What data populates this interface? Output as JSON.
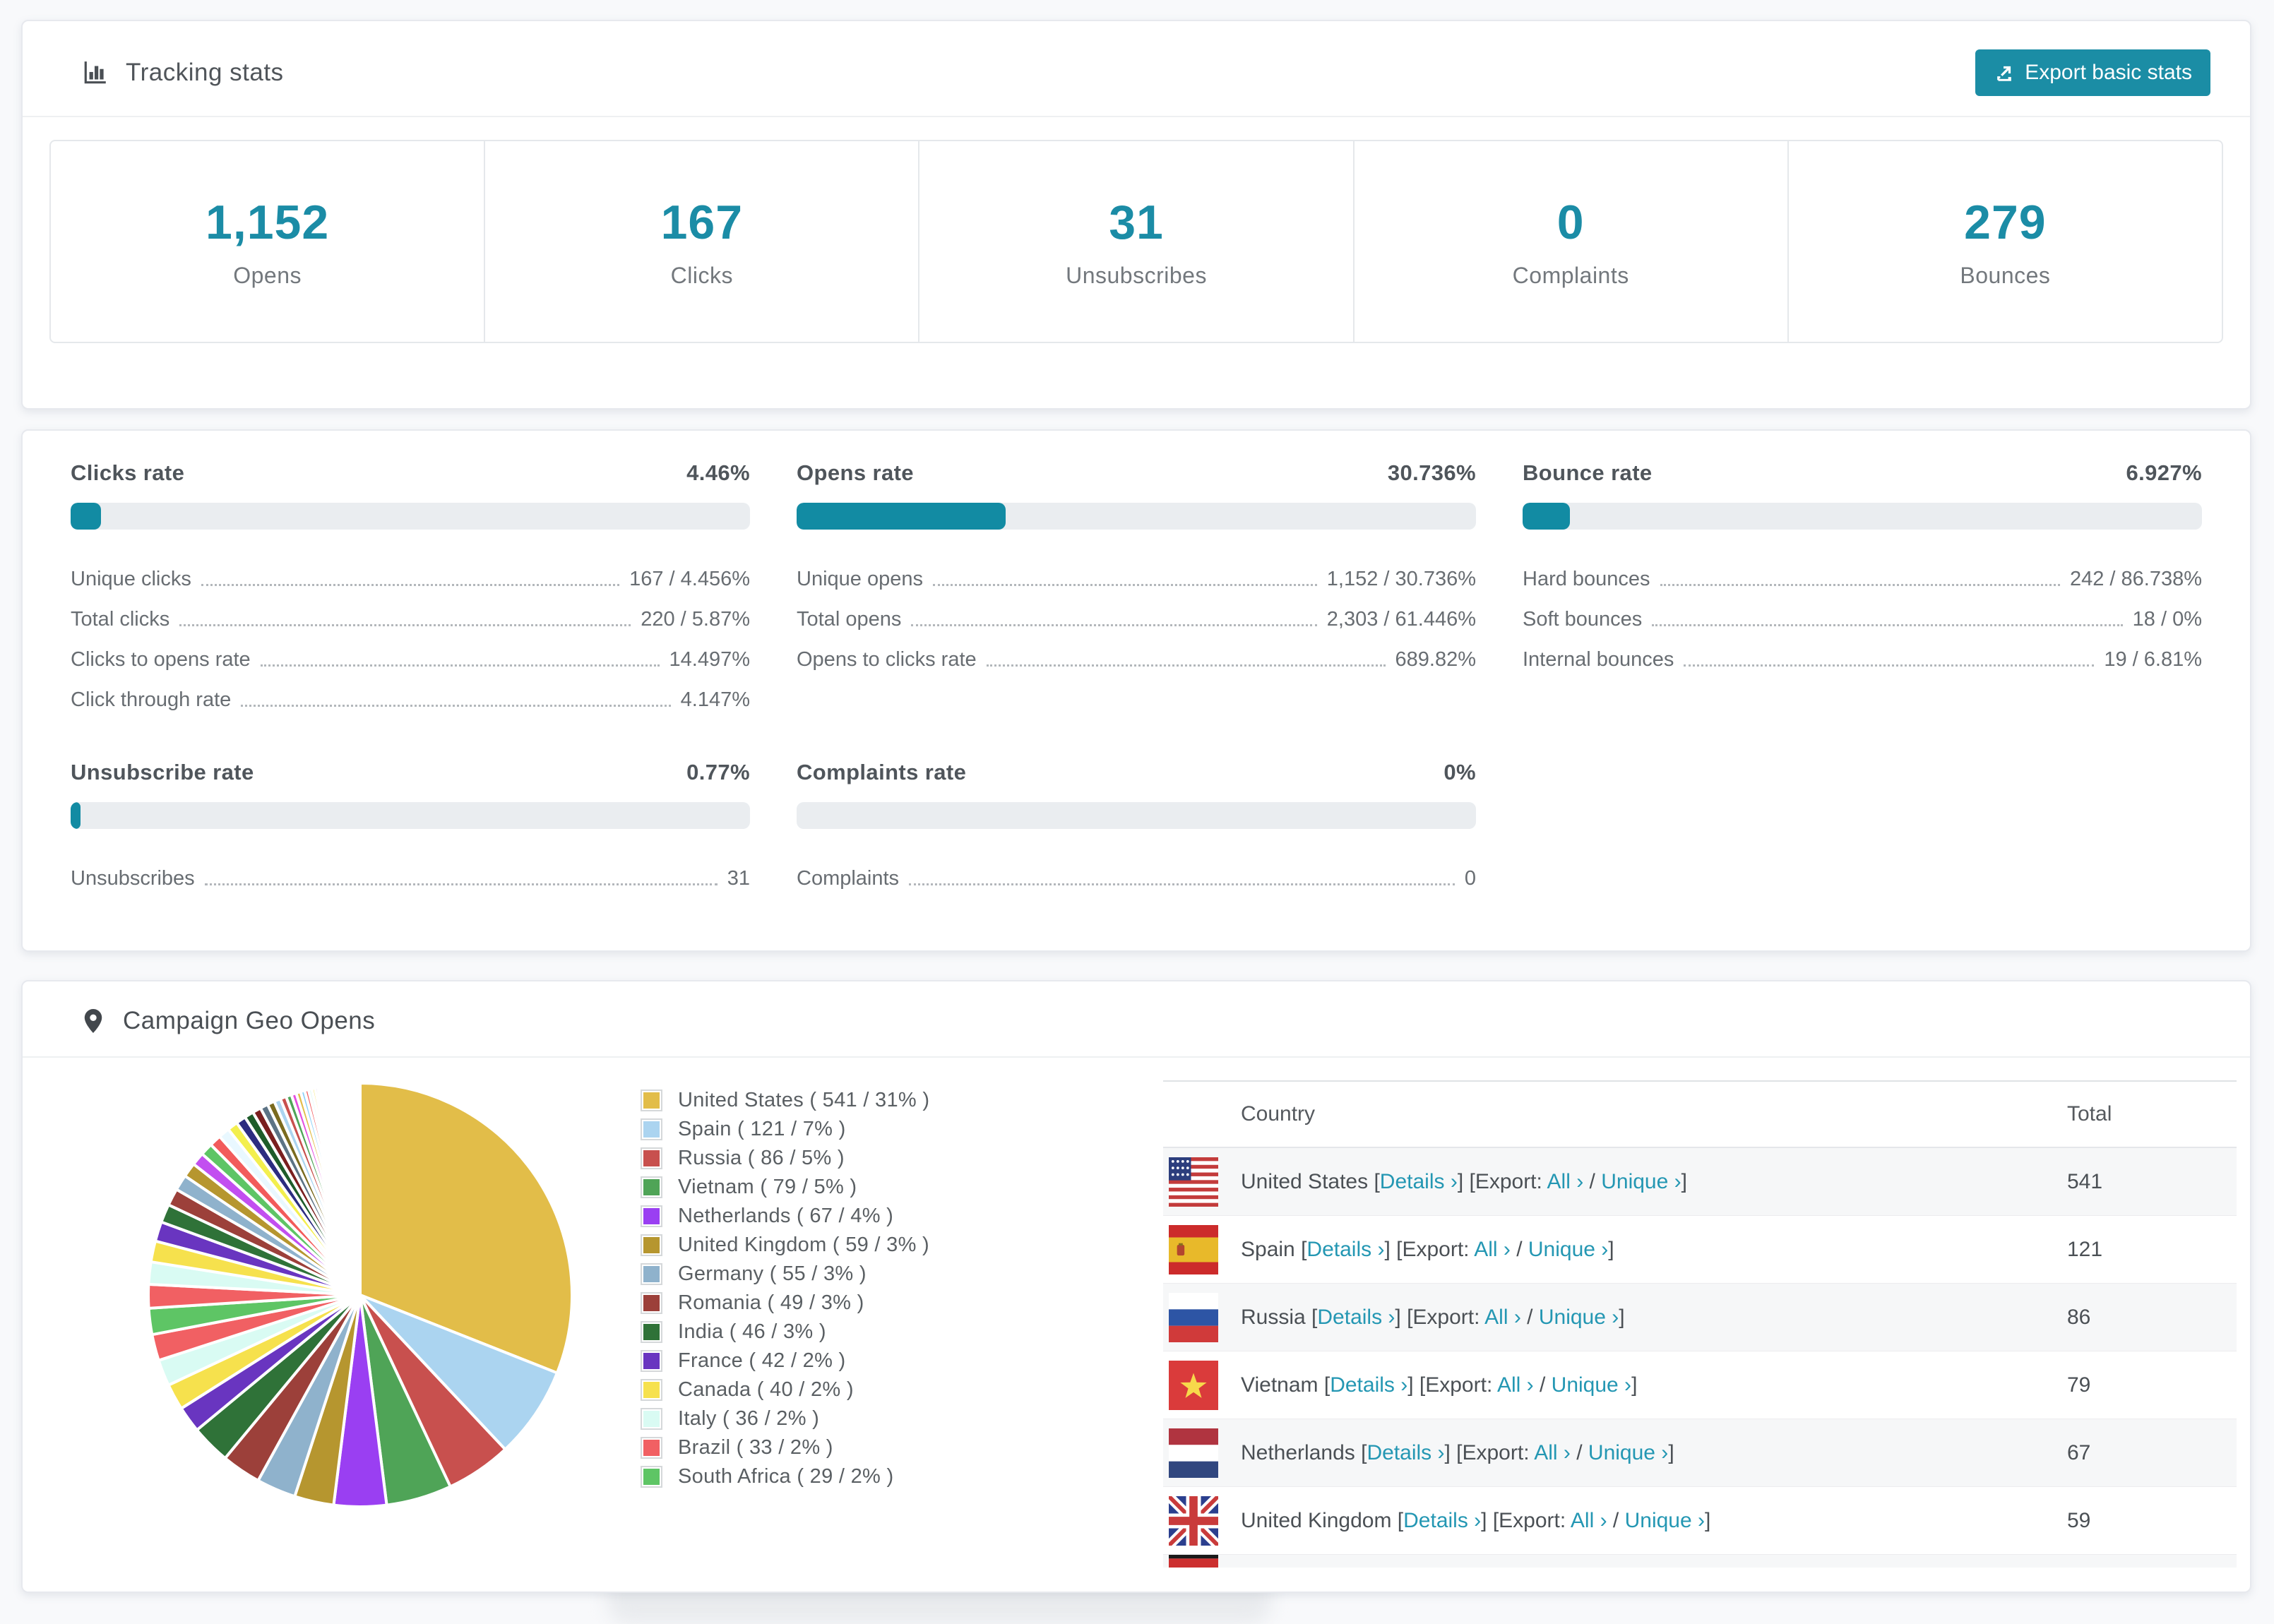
{
  "colors": {
    "accent_teal": "#1b8da5",
    "stat_number_teal": "#1b8ca6",
    "bar_fill_teal": "#128ba3",
    "link_teal": "#2497b3",
    "text_dark": "#4f555b",
    "text_gray": "#686d72"
  },
  "header": {
    "title": "Tracking stats",
    "export_label": "Export basic stats"
  },
  "summary_stats": [
    {
      "value": "1,152",
      "label": "Opens"
    },
    {
      "value": "167",
      "label": "Clicks"
    },
    {
      "value": "31",
      "label": "Unsubscribes"
    },
    {
      "value": "0",
      "label": "Complaints"
    },
    {
      "value": "279",
      "label": "Bounces"
    }
  ],
  "rates": [
    {
      "title": "Clicks rate",
      "value": "4.46%",
      "pct": 4.46,
      "rows": [
        {
          "label": "Unique clicks",
          "value": "167 / 4.456%"
        },
        {
          "label": "Total clicks",
          "value": "220 / 5.87%"
        },
        {
          "label": "Clicks to opens rate",
          "value": "14.497%"
        },
        {
          "label": "Click through rate",
          "value": "4.147%"
        }
      ]
    },
    {
      "title": "Opens rate",
      "value": "30.736%",
      "pct": 30.736,
      "rows": [
        {
          "label": "Unique opens",
          "value": "1,152 / 30.736%"
        },
        {
          "label": "Total opens",
          "value": "2,303 / 61.446%"
        },
        {
          "label": "Opens to clicks rate",
          "value": "689.82%"
        }
      ]
    },
    {
      "title": "Bounce rate",
      "value": "6.927%",
      "pct": 6.927,
      "rows": [
        {
          "label": "Hard bounces",
          "value": "242 / 86.738%"
        },
        {
          "label": "Soft bounces",
          "value": "18 / 0%"
        },
        {
          "label": "Internal bounces",
          "value": "19 / 6.81%"
        }
      ]
    },
    {
      "title": "Unsubscribe rate",
      "value": "0.77%",
      "pct": 0.77,
      "rows": [
        {
          "label": "Unsubscribes",
          "value": "31"
        }
      ]
    },
    {
      "title": "Complaints rate",
      "value": "0%",
      "pct": 0,
      "rows": [
        {
          "label": "Complaints",
          "value": "0"
        }
      ]
    }
  ],
  "geo": {
    "title": "Campaign Geo Opens",
    "table": {
      "columns": [
        "Country",
        "Total"
      ],
      "rows": [
        {
          "flag": "us",
          "country": "United States",
          "total": "541"
        },
        {
          "flag": "es",
          "country": "Spain",
          "total": "121"
        },
        {
          "flag": "ru",
          "country": "Russia",
          "total": "86"
        },
        {
          "flag": "vn",
          "country": "Vietnam",
          "total": "79"
        },
        {
          "flag": "nl",
          "country": "Netherlands",
          "total": "67"
        },
        {
          "flag": "gb",
          "country": "United Kingdom",
          "total": "59"
        }
      ],
      "partial_next_row": {
        "flag": "de"
      }
    },
    "row_links": {
      "details": "Details ›",
      "export_prefix": "[Export:",
      "all": "All ›",
      "separator": "/",
      "unique": "Unique ›"
    }
  },
  "chart_data": {
    "type": "pie",
    "title": "Campaign Geo Opens",
    "unit": "opens",
    "start": "top",
    "direction": "clockwise",
    "legend_position": "right",
    "legend_format": "name ( value / pct% )",
    "series": [
      {
        "name": "United States",
        "value": 541,
        "pct": 31,
        "color": "#e2bd49"
      },
      {
        "name": "Spain",
        "value": 121,
        "pct": 7,
        "color": "#abd4f0"
      },
      {
        "name": "Russia",
        "value": 86,
        "pct": 5,
        "color": "#c8504e"
      },
      {
        "name": "Vietnam",
        "value": 79,
        "pct": 5,
        "color": "#4fa457"
      },
      {
        "name": "Netherlands",
        "value": 67,
        "pct": 4,
        "color": "#9a3ff2"
      },
      {
        "name": "United Kingdom",
        "value": 59,
        "pct": 3,
        "color": "#b6962f"
      },
      {
        "name": "Germany",
        "value": 55,
        "pct": 3,
        "color": "#8fb2cc"
      },
      {
        "name": "Romania",
        "value": 49,
        "pct": 3,
        "color": "#9c403a"
      },
      {
        "name": "India",
        "value": 46,
        "pct": 3,
        "color": "#2f7238"
      },
      {
        "name": "France",
        "value": 42,
        "pct": 2,
        "color": "#6935c0"
      },
      {
        "name": "Canada",
        "value": 40,
        "pct": 2,
        "color": "#f6e14d"
      },
      {
        "name": "Italy",
        "value": 36,
        "pct": 2,
        "color": "#d9fbf3"
      },
      {
        "name": "Brazil",
        "value": 33,
        "pct": 2,
        "color": "#f16063"
      },
      {
        "name": "South Africa",
        "value": 29,
        "pct": 2,
        "color": "#5ec565"
      }
    ],
    "unlabeled_tail_pct": [
      1.8,
      1.7,
      1.6,
      1.5,
      1.4,
      1.3,
      1.2,
      1.1,
      1.0,
      0.95,
      0.9,
      0.85,
      0.8,
      0.75,
      0.7,
      0.65,
      0.6,
      0.55,
      0.5,
      0.46,
      0.42,
      0.38,
      0.35,
      0.32,
      0.29,
      0.26,
      0.24,
      0.22,
      0.2,
      0.18,
      0.16,
      0.14,
      0.13,
      0.12,
      0.11,
      0.1,
      0.09,
      0.08,
      0.07,
      0.06,
      0.05,
      0.05,
      0.04,
      0.04,
      0.03,
      0.03,
      0.02,
      0.02
    ],
    "tail_palette": [
      "#f16063",
      "#d9fbf3",
      "#f6e14d",
      "#6935c0",
      "#2f7238",
      "#9c403a",
      "#8fb2cc",
      "#b6962f",
      "#c24ff0",
      "#5ec565",
      "#f25b5b",
      "#e9f8ff",
      "#f3ef4e",
      "#2c2c80",
      "#1e5c2a",
      "#7a1f1f",
      "#5c7385",
      "#7a6a1f",
      "#abd4f0",
      "#c8504e",
      "#4fa457",
      "#e44fe0",
      "#e2bd49",
      "#8fd3f8"
    ]
  }
}
